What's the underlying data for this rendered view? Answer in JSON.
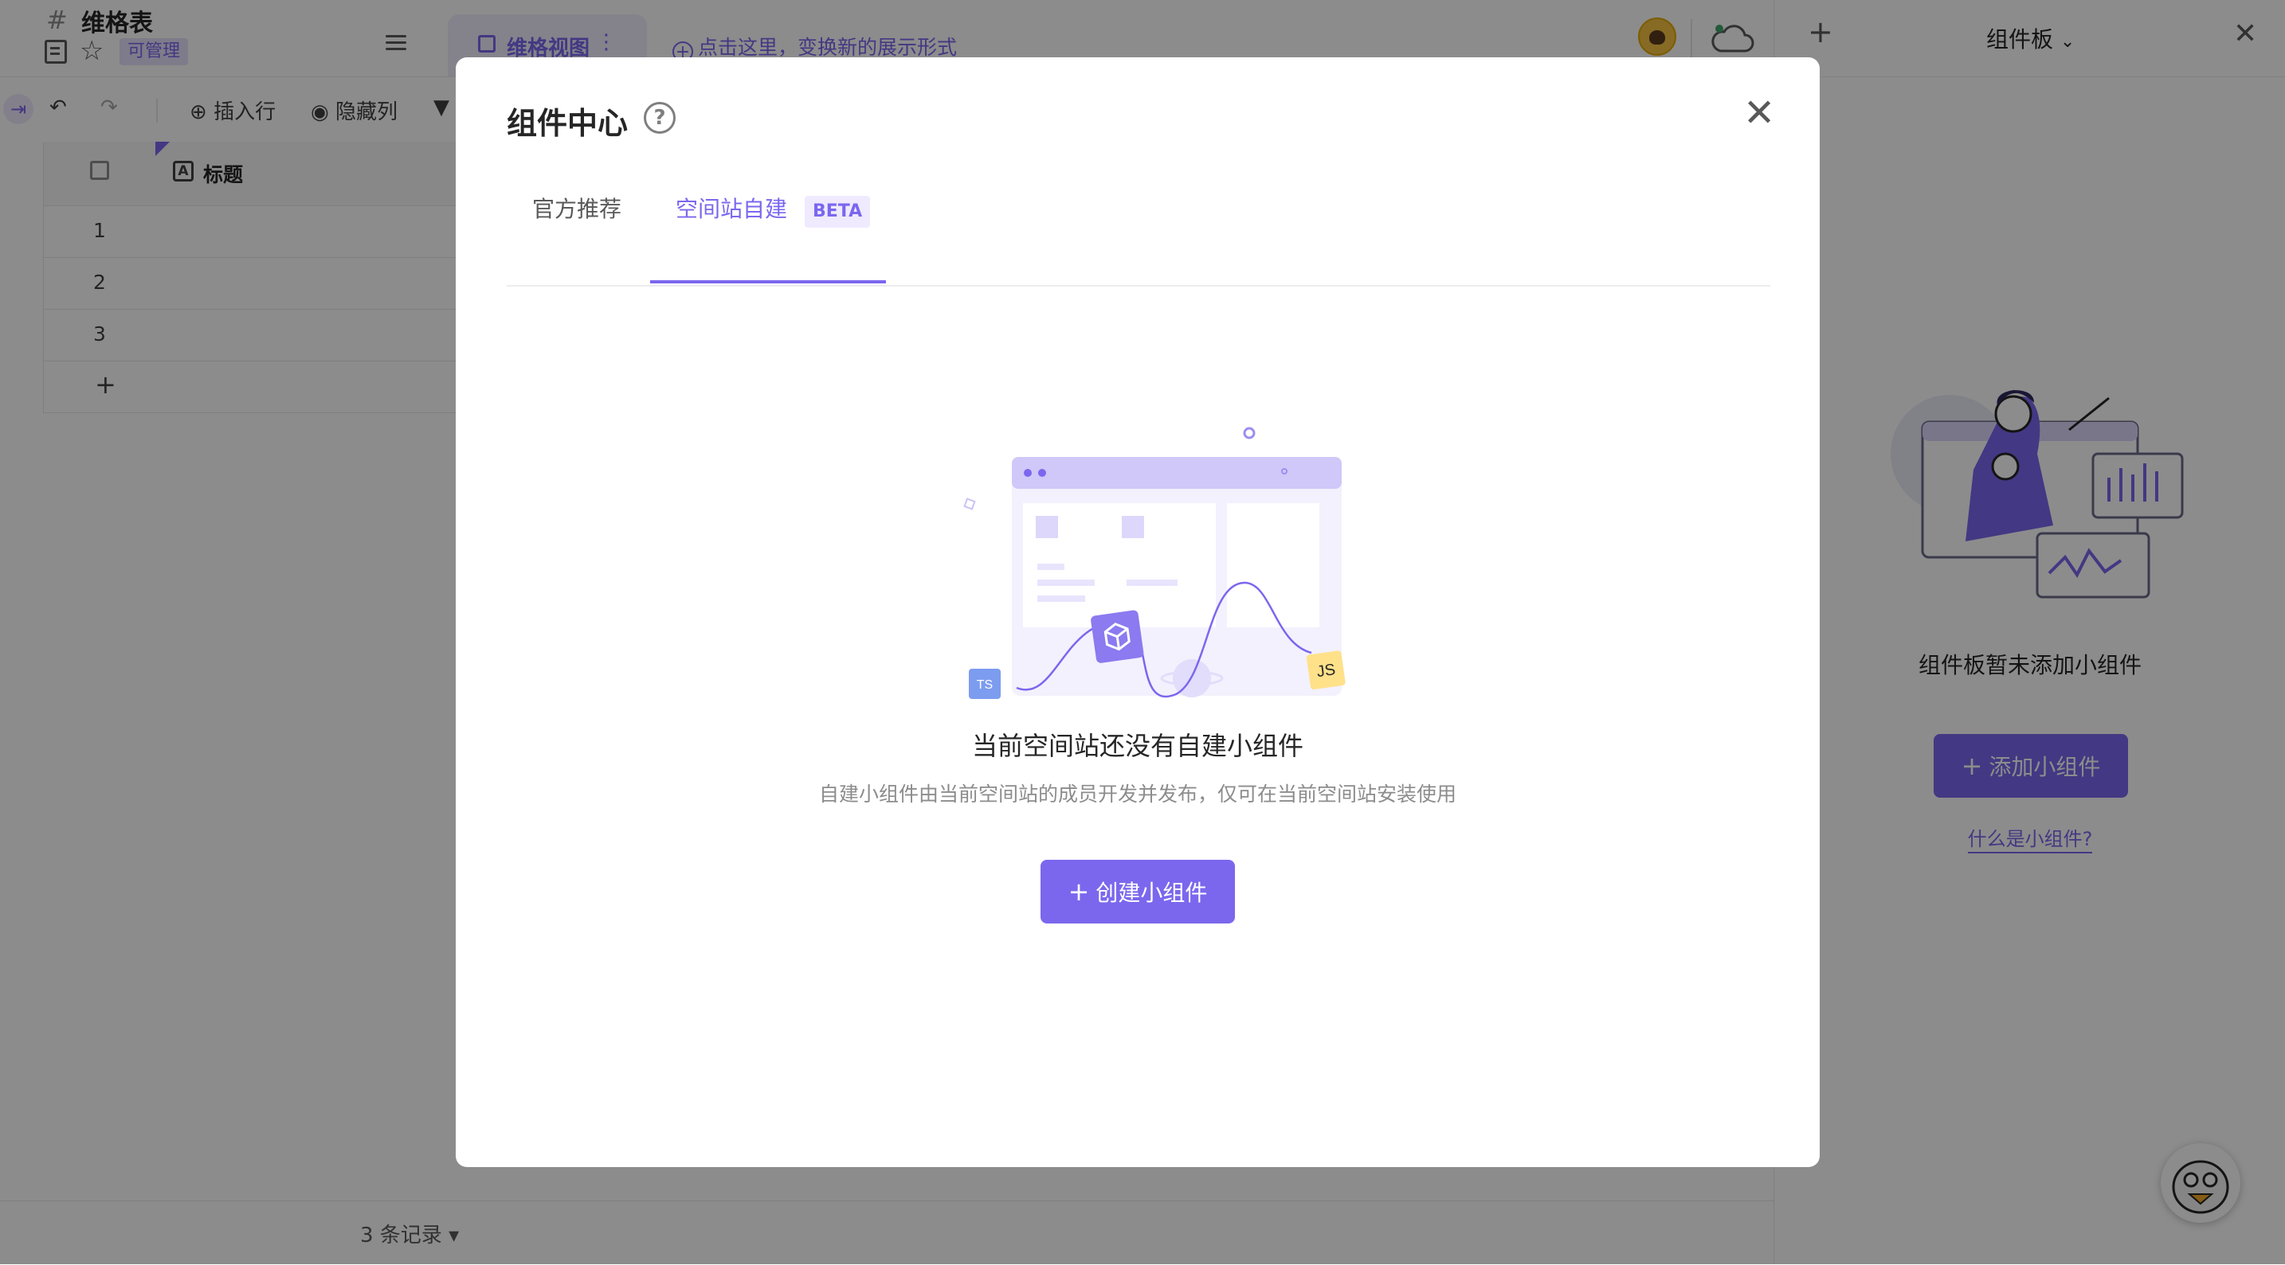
{
  "sheet": {
    "hash": "#",
    "title": "维格表",
    "permission": "可管理"
  },
  "view": {
    "name": "维格视图",
    "more": "⋮",
    "switch_hint": "点击这里，变换新的展示形式"
  },
  "toolbar": {
    "insert_row": "插入行",
    "hide_column": "隐藏列"
  },
  "grid": {
    "columns": [
      {
        "label": "标题"
      }
    ],
    "rows": [
      {
        "num": "1"
      },
      {
        "num": "2"
      },
      {
        "num": "3"
      }
    ],
    "add_row": "+"
  },
  "statusbar": {
    "record_count": "3 条记录 ▾"
  },
  "right_panel": {
    "title": "组件板",
    "empty_text": "组件板暂未添加小组件",
    "add_button": "添加小组件",
    "help_link": "什么是小组件?"
  },
  "modal": {
    "title": "组件中心",
    "tabs": [
      {
        "label": "官方推荐",
        "active": false
      },
      {
        "label": "空间站自建",
        "active": true,
        "badge": "BETA"
      }
    ],
    "illustration_labels": {
      "ts": "TS",
      "js": "JS"
    },
    "empty_title": "当前空间站还没有自建小组件",
    "empty_desc": "自建小组件由当前空间站的成员开发并发布，仅可在当前空间站安装使用",
    "create_button": "创建小组件"
  },
  "colors": {
    "accent": "#7b67ee",
    "accent_light": "#efeafe",
    "overlay": "rgba(0,0,0,0.45)"
  }
}
